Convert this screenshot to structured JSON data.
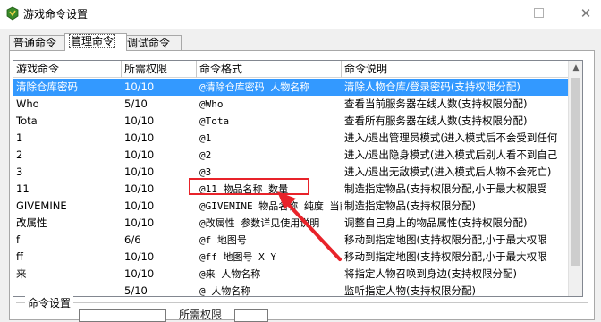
{
  "window": {
    "title": "游戏命令设置",
    "minimize_glyph": "—",
    "close_glyph": "✕"
  },
  "tabs": [
    {
      "label": "普通命令"
    },
    {
      "label": "管理命令"
    },
    {
      "label": "调试命令"
    }
  ],
  "grid": {
    "columns": [
      {
        "label": "游戏命令"
      },
      {
        "label": "所需权限"
      },
      {
        "label": "命令格式"
      },
      {
        "label": "命令说明"
      }
    ],
    "rows": [
      {
        "cmd": "清除仓库密码",
        "perm": "10/10",
        "format": "@清除仓库密码 人物名称",
        "desc": "清除人物仓库/登录密码(支持权限分配)"
      },
      {
        "cmd": "Who",
        "perm": "5/10",
        "format": "@Who",
        "desc": "查看当前服务器在线人数(支持权限分配)"
      },
      {
        "cmd": "Tota",
        "perm": "10/10",
        "format": "@Tota",
        "desc": "查看所有服务器在线人数(支持权限分配)"
      },
      {
        "cmd": "1",
        "perm": "10/10",
        "format": "@1",
        "desc": "进入/退出管理员模式(进入模式后不会受到任何"
      },
      {
        "cmd": "2",
        "perm": "10/10",
        "format": "@2",
        "desc": "进入/退出隐身模式(进入模式后别人看不到自己"
      },
      {
        "cmd": "3",
        "perm": "10/10",
        "format": "@3",
        "desc": "进入/退出无敌模式(进入模式后人物不会死亡)"
      },
      {
        "cmd": "11",
        "perm": "10/10",
        "format": "@11 物品名称 数量",
        "desc": "制造指定物品(支持权限分配,小于最大权限受"
      },
      {
        "cmd": "GIVEMINE",
        "perm": "10/10",
        "format": "@GIVEMINE 物品名称 纯度 当前",
        "desc": "制造指定物品(支持权限分配)"
      },
      {
        "cmd": "改属性",
        "perm": "10/10",
        "format": "@改属性 参数详见使用说明",
        "desc": "调整自己身上的物品属性(支持权限分配)"
      },
      {
        "cmd": "f",
        "perm": "6/6",
        "format": "@f 地图号",
        "desc": "移动到指定地图(支持权限分配,小于最大权限"
      },
      {
        "cmd": "ff",
        "perm": "10/10",
        "format": "@ff 地图号 X Y",
        "desc": "移动到指定地图(支持权限分配,小于最大权限"
      },
      {
        "cmd": "来",
        "perm": "10/10",
        "format": "@来 人物名称",
        "desc": "将指定人物召唤到身边(支持权限分配)"
      },
      {
        "cmd": "",
        "perm": "5/10",
        "format": "@  人物名称",
        "desc": "监听指定人物(支持权限分配)"
      }
    ]
  },
  "group": {
    "title": "命令设置",
    "field_label": "所需权限"
  },
  "colors": {
    "selection": "#3399ff",
    "annotation": "#e8232a"
  }
}
